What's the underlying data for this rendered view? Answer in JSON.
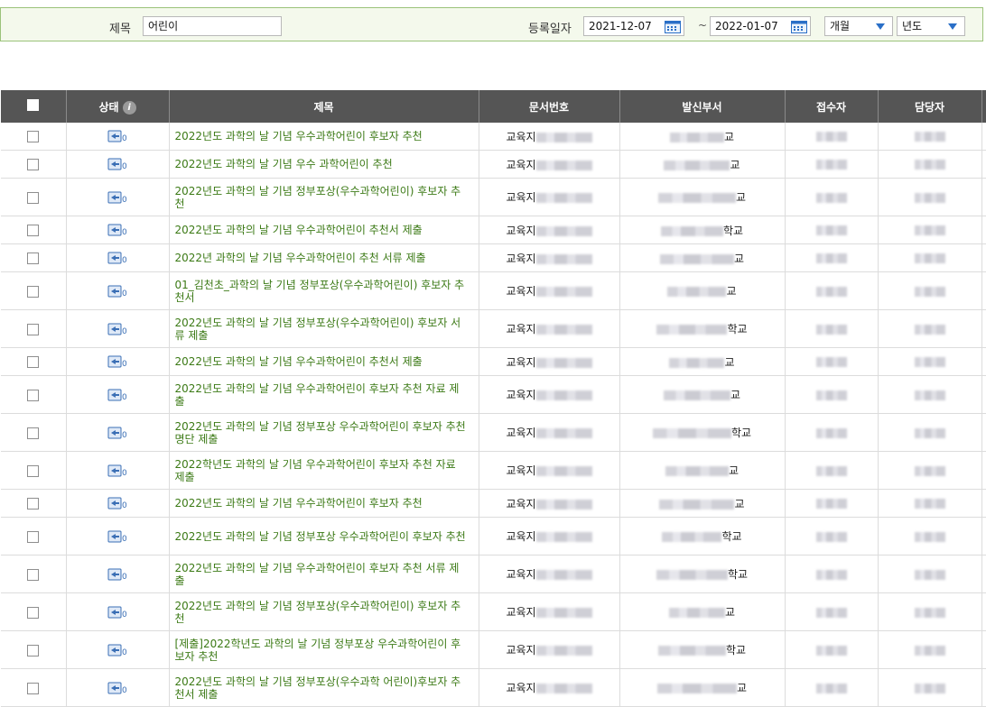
{
  "search": {
    "title_label": "제목",
    "title_value": "어린이",
    "date_label": "등록일자",
    "date_from": "2021-12-07",
    "date_sep": "~",
    "date_to": "2022-01-07",
    "period_select": "개월",
    "year_select": "년도"
  },
  "table": {
    "headers": {
      "status": "상태",
      "title": "제목",
      "doc_no": "문서번호",
      "dept": "발신부서",
      "receiver": "접수자",
      "manager": "담당자"
    },
    "doc_prefix": "교육지",
    "dept_suffix_school": "학교",
    "dept_suffix_short": "교",
    "rows": [
      {
        "title": "2022년도 과학의 날 기념 우수과학어린이 후보자 추천",
        "dept_suffix": "교"
      },
      {
        "title": "2022년도 과학의 날 기념 우수 과학어린이 추천",
        "dept_suffix": "교"
      },
      {
        "title": "2022년도 과학의 날 기념 정부포상(우수과학어린이) 후보자 추천",
        "dept_suffix": "교"
      },
      {
        "title": "2022년도 과학의 날 기념 우수과학어린이 추천서 제출",
        "dept_suffix": "학교"
      },
      {
        "title": "2022년 과학의 날 기념 우수과학어린이 추천 서류 제출",
        "dept_suffix": "교"
      },
      {
        "title": "01_김천초_과학의 날 기념 정부포상(우수과학어린이) 후보자 추천서",
        "dept_suffix": "교"
      },
      {
        "title": "2022년도 과학의 날 기념 정부포상(우수과학어린이) 후보자 서류 제출",
        "dept_suffix": "학교"
      },
      {
        "title": "2022년도 과학의 날 기념 우수과학어린이 추천서 제출",
        "dept_suffix": "교"
      },
      {
        "title": "2022년도 과학의 날 기념 우수과학어린이 후보자 추천 자료 제출",
        "dept_suffix": "교"
      },
      {
        "title": "2022년도 과학의 날 기념 정부포상 우수과학어린이 후보자 추천명단 제출",
        "dept_suffix": "학교"
      },
      {
        "title": "2022학년도 과학의 날 기념 우수과학어린이 후보자 추천 자료 제출",
        "dept_suffix": "교"
      },
      {
        "title": "2022년도 과학의 날 기념 우수과학어린이 후보자 추천",
        "dept_suffix": "교"
      },
      {
        "title": "2022년도 과학의 날 기념 정부포상 우수과학어린이 후보자 추천",
        "dept_suffix": "학교"
      },
      {
        "title": "2022년도 과학의 날 기념 우수과학어린이 후보자 추천 서류 제출",
        "dept_suffix": "학교"
      },
      {
        "title": "2022년도 과학의 날 기념 정부포상(우수과학어린이) 후보자 추천",
        "dept_suffix": "교"
      },
      {
        "title": "[제출]2022학년도 과학의 날 기념 정부포상 우수과학어린이 후보자 추천",
        "dept_suffix": "학교"
      },
      {
        "title": "2022년도 과학의 날 기념 정부포상(우수과학 어린이)후보자 추천서 제출",
        "dept_suffix": "교"
      }
    ]
  },
  "colors": {
    "header_bg": "#555555",
    "title_text": "#3c7a16",
    "search_bg": "#f4f9ec",
    "search_border": "#9bc37a",
    "select_caret": "#2a6fc7"
  },
  "icons": {
    "status": "document-status-icon",
    "info": "info-icon",
    "calendar": "calendar-icon",
    "dropdown": "chevron-down-icon"
  }
}
